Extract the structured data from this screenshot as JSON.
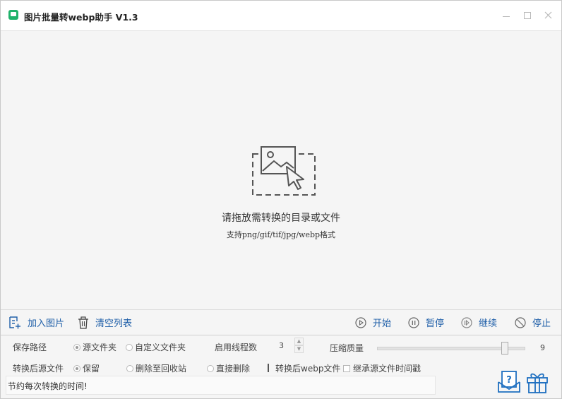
{
  "window": {
    "title": "图片批量转webp助手 V1.3"
  },
  "dropzone": {
    "main_text": "请拖放需转换的目录或文件",
    "sub_text": "支持png/gif/tif/jpg/webp格式"
  },
  "toolbar": {
    "add_images": "加入图片",
    "clear_list": "清空列表",
    "start": "开始",
    "pause": "暂停",
    "resume": "继续",
    "stop": "停止"
  },
  "settings": {
    "save_path_label": "保存路径",
    "save_path_options": [
      "源文件夹",
      "自定义文件夹"
    ],
    "save_path_selected": "源文件夹",
    "threads_label": "启用线程数",
    "threads_value": "3",
    "quality_label": "压缩质量",
    "quality_value": "9",
    "source_after_label": "转换后源文件",
    "source_after_options": [
      "保留",
      "删除至回收站",
      "直接删除"
    ],
    "source_after_selected": "保留",
    "webp_after_label": "转换后webp文件",
    "inherit_time_label": "继承源文件时间戳",
    "inherit_time_checked": false
  },
  "status": {
    "text": "节约每次转换的时间!"
  },
  "icons": {
    "app": "app-logo-icon",
    "add": "add-image-icon",
    "clear": "trash-icon",
    "start": "play-circle-icon",
    "pause": "pause-circle-icon",
    "resume": "resume-circle-icon",
    "stop": "stop-circle-icon",
    "help": "help-mail-icon",
    "gift": "gift-icon"
  },
  "colors": {
    "accent": "#1e5ea8",
    "app_icon": "#20b26b"
  }
}
